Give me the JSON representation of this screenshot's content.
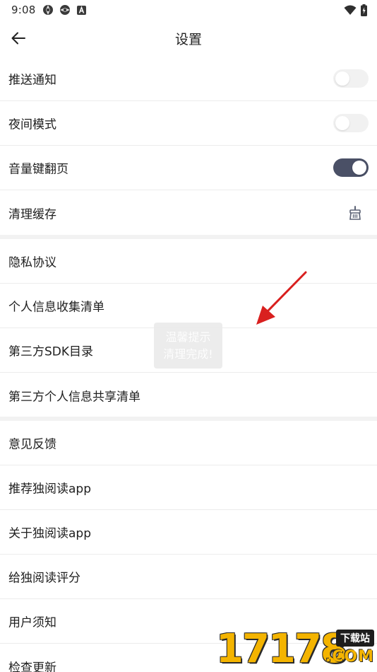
{
  "status_bar": {
    "time": "9:08",
    "left_icons": [
      "aperture-icon",
      "aperture-icon",
      "letter-a-badge-icon"
    ],
    "right_icons": [
      "wifi-icon",
      "battery-charging-icon"
    ]
  },
  "header": {
    "title": "设置",
    "back_icon": "arrow-left-icon"
  },
  "sections": [
    {
      "items": [
        {
          "label": "推送通知",
          "control": "toggle",
          "on": false
        },
        {
          "label": "夜间模式",
          "control": "toggle",
          "on": false
        },
        {
          "label": "音量键翻页",
          "control": "toggle",
          "on": true
        },
        {
          "label": "清理缓存",
          "control": "icon",
          "icon": "broom-icon"
        }
      ]
    },
    {
      "items": [
        {
          "label": "隐私协议"
        },
        {
          "label": "个人信息收集清单"
        },
        {
          "label": "第三方SDK目录"
        },
        {
          "label": "第三方个人信息共享清单"
        }
      ]
    },
    {
      "items": [
        {
          "label": "意见反馈"
        },
        {
          "label": "推荐独阅读app"
        },
        {
          "label": "关于独阅读app"
        },
        {
          "label": "给独阅读评分"
        },
        {
          "label": "用户须知"
        },
        {
          "label": "检查更新"
        }
      ]
    }
  ],
  "toast": {
    "line1": "温馨提示",
    "line2": "清理完成!"
  },
  "watermark": {
    "digits": "17178",
    "tag": "下载站",
    "suffix": ".COM"
  },
  "colors": {
    "toggle_on": "#4a5066",
    "toggle_off": "#f1f1f1",
    "section_gap": "#f2f2f2",
    "annotation_arrow": "#d9201f",
    "watermark_yellow": "#f4b400"
  }
}
